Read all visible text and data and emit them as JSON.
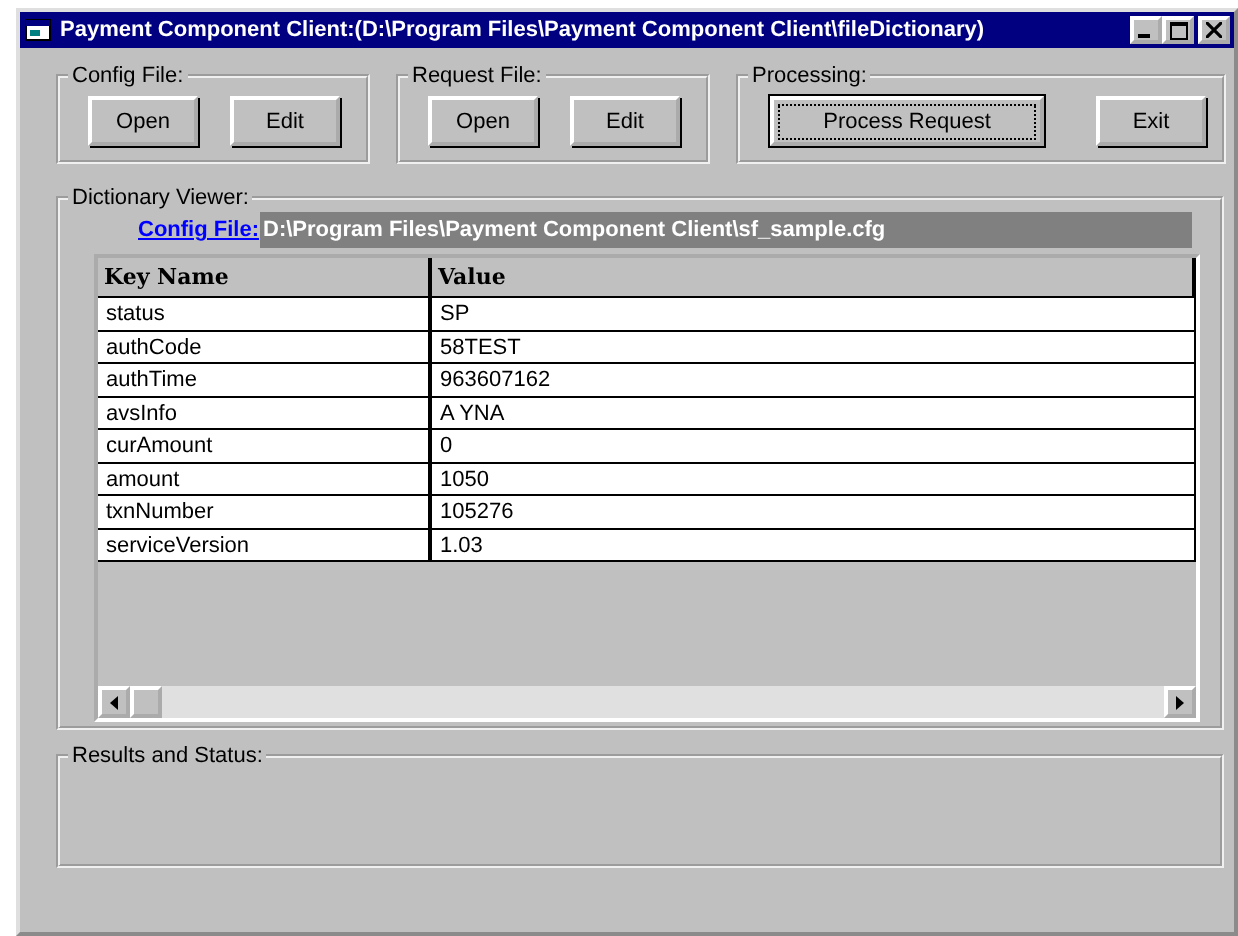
{
  "window": {
    "title": "Payment Component Client:(D:\\Program Files\\Payment Component Client\\fileDictionary)"
  },
  "groups": [
    {
      "title": "Config File:",
      "buttons": [
        {
          "label": "Open",
          "default": false
        },
        {
          "label": "Edit",
          "default": false
        }
      ]
    },
    {
      "title": "Request File:",
      "buttons": [
        {
          "label": "Open",
          "default": false
        },
        {
          "label": "Edit",
          "default": false
        }
      ]
    },
    {
      "title": "Processing:",
      "buttons": [
        {
          "label": "Process Request",
          "default": true
        },
        {
          "label": "Exit",
          "default": false
        }
      ]
    }
  ],
  "dictionary_viewer": {
    "title": "Dictionary Viewer:",
    "config_link": "Config File:",
    "path": "D:\\Program Files\\Payment Component Client\\sf_sample.cfg",
    "table": {
      "columns": [
        "Key Name",
        "Value"
      ],
      "rows": [
        [
          "status",
          "SP"
        ],
        [
          "authCode",
          "58TEST"
        ],
        [
          "authTime",
          "963607162"
        ],
        [
          "avsInfo",
          "A YNA"
        ],
        [
          "curAmount",
          "0"
        ],
        [
          "amount",
          "1050"
        ],
        [
          "txnNumber",
          "105276"
        ],
        [
          "serviceVersion",
          "1.03"
        ]
      ]
    }
  },
  "results": {
    "title": "Results and Status:"
  }
}
